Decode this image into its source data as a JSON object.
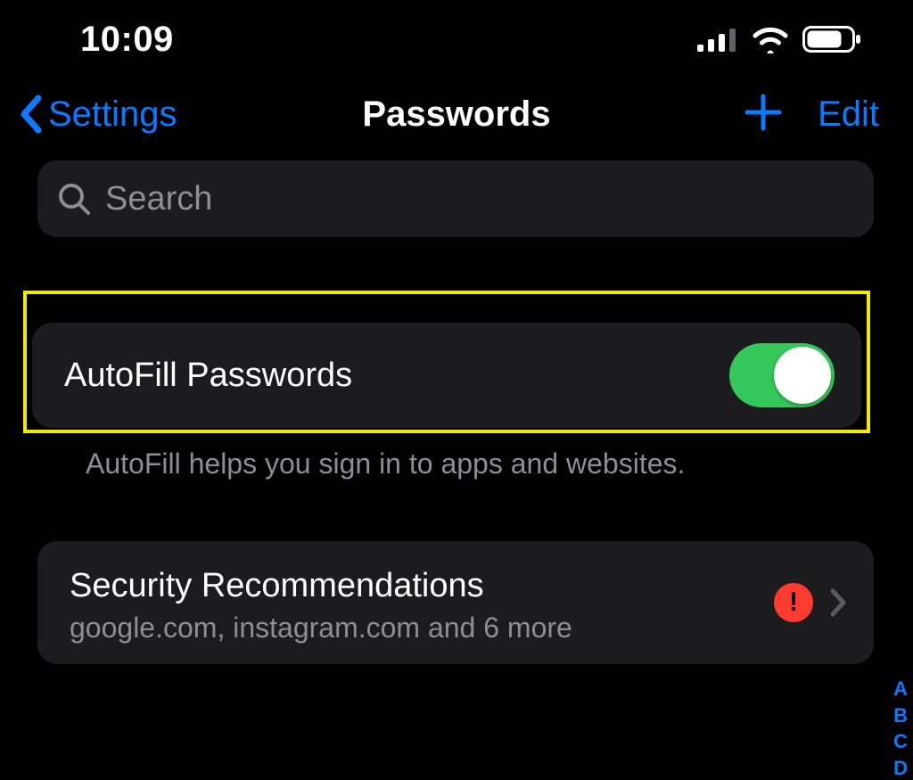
{
  "statusbar": {
    "time": "10:09"
  },
  "nav": {
    "back_label": "Settings",
    "title": "Passwords",
    "edit_label": "Edit"
  },
  "search": {
    "placeholder": "Search",
    "value": ""
  },
  "autofill": {
    "label": "AutoFill Passwords",
    "footer": "AutoFill helps you sign in to apps and websites.",
    "enabled": true
  },
  "security": {
    "title": "Security Recommendations",
    "subtitle": "google.com, instagram.com and 6 more",
    "alert": true
  },
  "index_letters": [
    "A",
    "B",
    "C",
    "D"
  ]
}
